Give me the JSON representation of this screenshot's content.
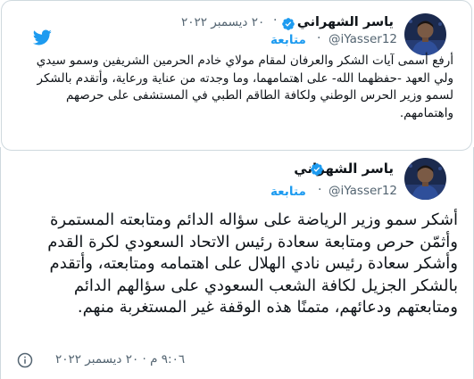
{
  "quoted_tweet": {
    "author_name": "ياسر الشهراني",
    "handle": "@iYasser12",
    "separator": "·",
    "date": "٢٠ ديسمبر ٢٠٢٢",
    "follow_label": "متابعة",
    "text": "أرفع أسمى آيات الشكر والعرفان لمقام مولاي خادم الحرمين الشريفين وسمو سيدي ولي العهد -حفظهما الله- على اهتمامهما، وما وجدته من عناية ورعاية، وأتقدم بالشكر لسمو وزير الحرس الوطني ولكافة الطاقم الطبي في المستشفى على حرصهم واهتمامهم."
  },
  "main_tweet": {
    "author_name": "ياسر الشهراني",
    "handle": "@iYasser12",
    "follow_label": "متابعة",
    "text": "أشكر سمو وزير الرياضة على سؤاله الدائم ومتابعته المستمرة وأثمّن حرص ومتابعة سعادة رئيس الاتحاد السعودي لكرة القدم وأشكر سعادة رئيس نادي الهلال على اهتمامه ومتابعته، وأتقدم بالشكر الجزيل لكافة الشعب السعودي على سؤالهم الدائم ومتابعتهم ودعائهم، متمنًا هذه الوقفة غير المستغربة منهم.",
    "timestamp": "٩:٠٦ م · ٢٠ ديسمبر ٢٠٢٢"
  },
  "icons": {
    "brand": "twitter-bird-icon",
    "verified": "verified-badge-icon",
    "info": "info-icon"
  },
  "colors": {
    "accent": "#1d9bf0",
    "text": "#0f1419",
    "secondary": "#536471",
    "border": "#cfd9de"
  }
}
